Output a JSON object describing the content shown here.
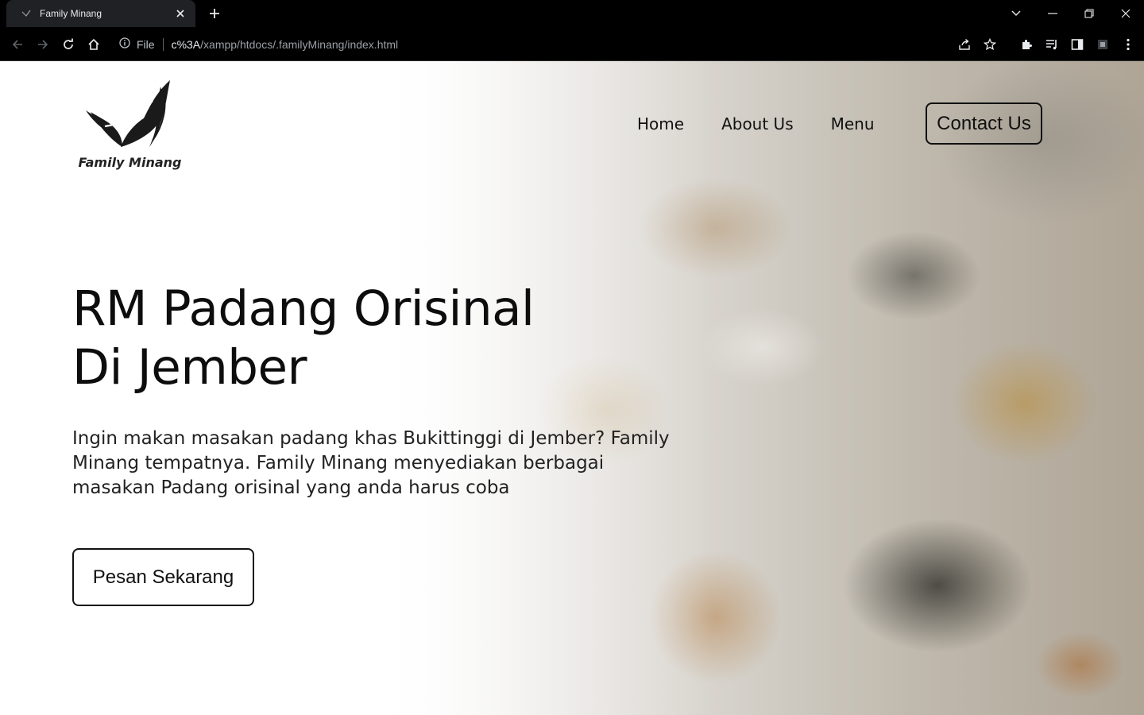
{
  "browser": {
    "tab_title": "Family Minang",
    "url_scheme_label": "File",
    "url_host": "c%3A",
    "url_path": "/xampp/htdocs/.familyMinang/index.html"
  },
  "site": {
    "brand_name": "Family Minang",
    "nav": {
      "home": "Home",
      "about": "About Us",
      "menu": "Menu",
      "contact": "Contact Us"
    },
    "hero": {
      "headline_line1": "RM Padang Orisinal",
      "headline_line2": "Di Jember",
      "description": "Ingin makan masakan padang khas Bukittinggi di Jember? Family Minang tempatnya. Family Minang menyediakan berbagai masakan Padang orisinal yang anda harus coba",
      "cta_label": "Pesan Sekarang"
    }
  },
  "icons": {
    "browser": [
      "back-icon",
      "forward-icon",
      "reload-icon",
      "home-icon",
      "info-icon",
      "share-icon",
      "star-icon",
      "extensions-icon",
      "reading-list-icon",
      "side-panel-icon",
      "profile-icon",
      "kebab-menu-icon"
    ],
    "window": [
      "tab-search-icon",
      "minimize-icon",
      "restore-icon",
      "close-icon"
    ]
  },
  "colors": {
    "chrome_bg": "#000000",
    "tab_bg": "#202124",
    "page_bg": "#ffffff",
    "text": "#111111"
  }
}
